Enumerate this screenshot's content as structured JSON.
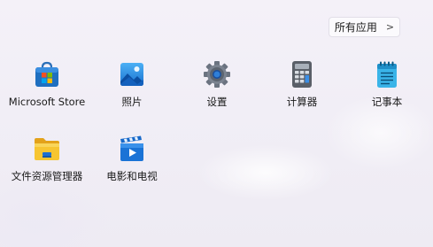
{
  "header": {
    "all_apps_label": "所有应用",
    "all_apps_chevron": ">"
  },
  "pinned_apps": [
    {
      "label": "Microsoft Store",
      "icon": "microsoft-store-icon"
    },
    {
      "label": "照片",
      "icon": "photos-icon"
    },
    {
      "label": "设置",
      "icon": "settings-gear-icon"
    },
    {
      "label": "计算器",
      "icon": "calculator-icon"
    },
    {
      "label": "记事本",
      "icon": "notepad-icon"
    },
    {
      "label": "文件资源管理器",
      "icon": "file-explorer-icon"
    },
    {
      "label": "电影和电视",
      "icon": "movies-tv-icon"
    }
  ],
  "colors": {
    "background": "#f2eff7",
    "button_bg": "#fbfafd",
    "text": "#1b1b1b"
  }
}
